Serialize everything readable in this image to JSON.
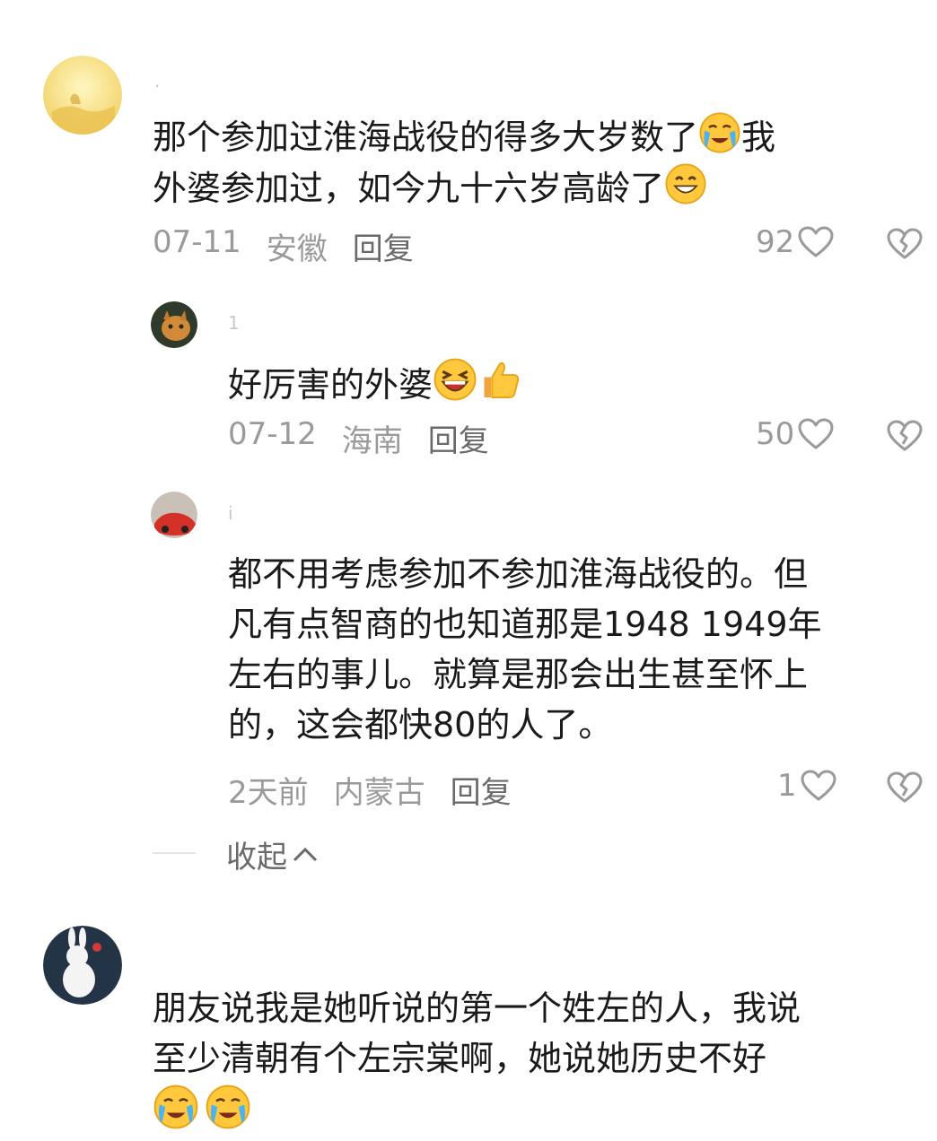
{
  "comments": [
    {
      "username": ".",
      "text_lines": [
        "那个参加过淮海战役的得多大岁数了",
        "外婆参加过，如今九十六岁高龄了"
      ],
      "text_line1_tail": "我",
      "emoji1": "crying-face",
      "emoji2": "grinning-face",
      "date": "07-11",
      "location": "安徽",
      "reply_label": "回复",
      "likes": "92"
    },
    {
      "username": "1",
      "text": "好厉害的外婆",
      "emojis": [
        "laughing-face",
        "thumbs-up"
      ],
      "date": "07-12",
      "location": "海南",
      "reply_label": "回复",
      "likes": "50"
    },
    {
      "username": "i",
      "text_lines": [
        "都不用考虑参加不参加淮海战役的。但",
        "凡有点智商的也知道那是1948 1949年",
        "左右的事儿。就算是那会出生甚至怀上",
        "的，这会都快80的人了。"
      ],
      "date": "2天前",
      "location": "内蒙古",
      "reply_label": "回复",
      "likes": "1"
    }
  ],
  "collapse_label": "收起",
  "last_comment": {
    "text_lines": [
      "朋友说我是她听说的第一个姓左的人，我说",
      "至少清朝有个左宗棠啊，她说她历史不好"
    ],
    "emojis": [
      "crying-face",
      "crying-face"
    ]
  },
  "colors": {
    "meta": "#9a9a9a",
    "reply": "#6a6a6a",
    "text": "#1a1a1a"
  },
  "icons": [
    "heart-outline-icon",
    "broken-heart-icon",
    "chevron-up-icon"
  ]
}
